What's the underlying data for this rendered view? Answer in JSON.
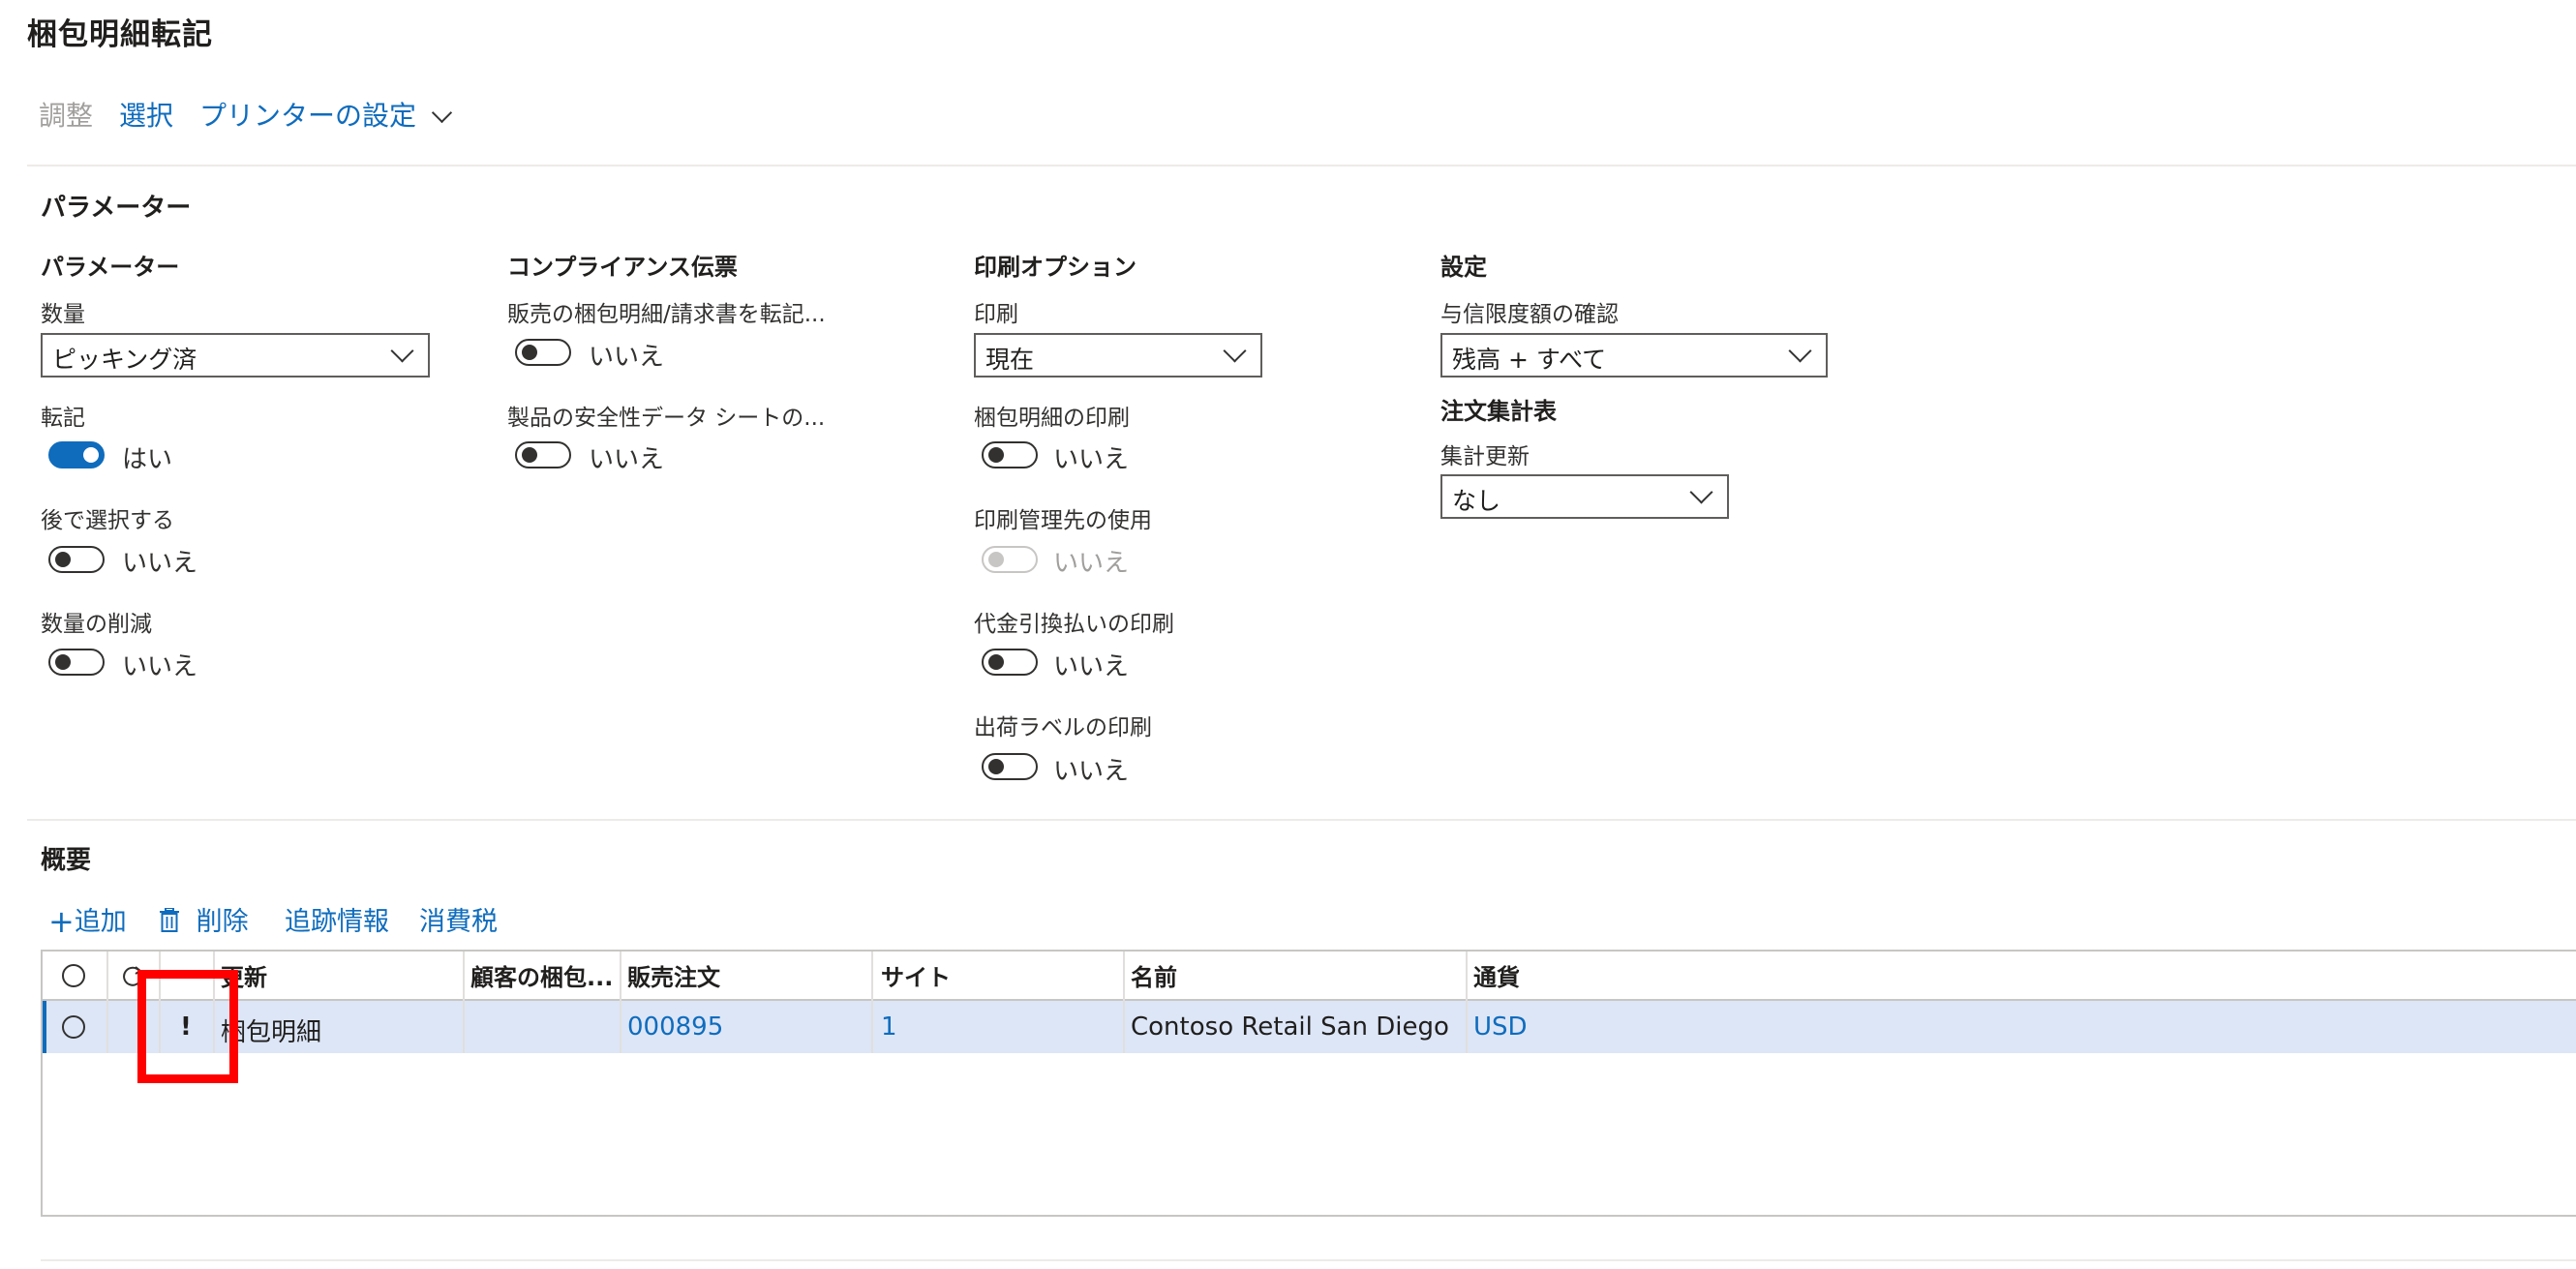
{
  "page": {
    "title": "梱包明細転記"
  },
  "toolbar": {
    "adjust": "調整",
    "select": "選択",
    "printer_settings": "プリンターの設定"
  },
  "parameters": {
    "section_title": "パラメーター",
    "group_parameters": {
      "title": "パラメーター",
      "quantity_label": "数量",
      "quantity_value": "ピッキング済",
      "posting_label": "転記",
      "posting_value": "はい",
      "select_later_label": "後で選択する",
      "select_later_value": "いいえ",
      "quantity_reduction_label": "数量の削減",
      "quantity_reduction_value": "いいえ"
    },
    "group_compliance": {
      "title": "コンプライアンス伝票",
      "sales_packing_label": "販売の梱包明細/請求書を転記...",
      "sales_packing_value": "いいえ",
      "safety_data_label": "製品の安全性データ シートの...",
      "safety_data_value": "いいえ"
    },
    "group_print": {
      "title": "印刷オプション",
      "print_label": "印刷",
      "print_value": "現在",
      "print_packing_label": "梱包明細の印刷",
      "print_packing_value": "いいえ",
      "print_management_label": "印刷管理先の使用",
      "print_management_value": "いいえ",
      "print_cod_label": "代金引換払いの印刷",
      "print_cod_value": "いいえ",
      "print_shipping_label": "出荷ラベルの印刷",
      "print_shipping_value": "いいえ"
    },
    "group_settings": {
      "title": "設定",
      "credit_limit_label": "与信限度額の確認",
      "credit_limit_value": "残高 + すべて",
      "order_summary_title": "注文集計表",
      "summary_update_label": "集計更新",
      "summary_update_value": "なし"
    }
  },
  "overview": {
    "section_title": "概要",
    "actions": {
      "add": "追加",
      "delete": "削除",
      "tracking": "追跡情報",
      "sales_tax": "消費税"
    },
    "columns": [
      "更新",
      "顧客の梱包...",
      "販売注文",
      "サイト",
      "名前",
      "通貨"
    ],
    "rows": [
      {
        "flag": "!",
        "update": "梱包明細",
        "customer_packing": "",
        "sales_order": "000895",
        "site": "1",
        "name": "Contoso Retail San Diego",
        "currency": "USD"
      }
    ]
  },
  "colors": {
    "accent": "#0f6cbd",
    "selected_row": "#dde6f7",
    "highlight_box": "#ff0000"
  }
}
